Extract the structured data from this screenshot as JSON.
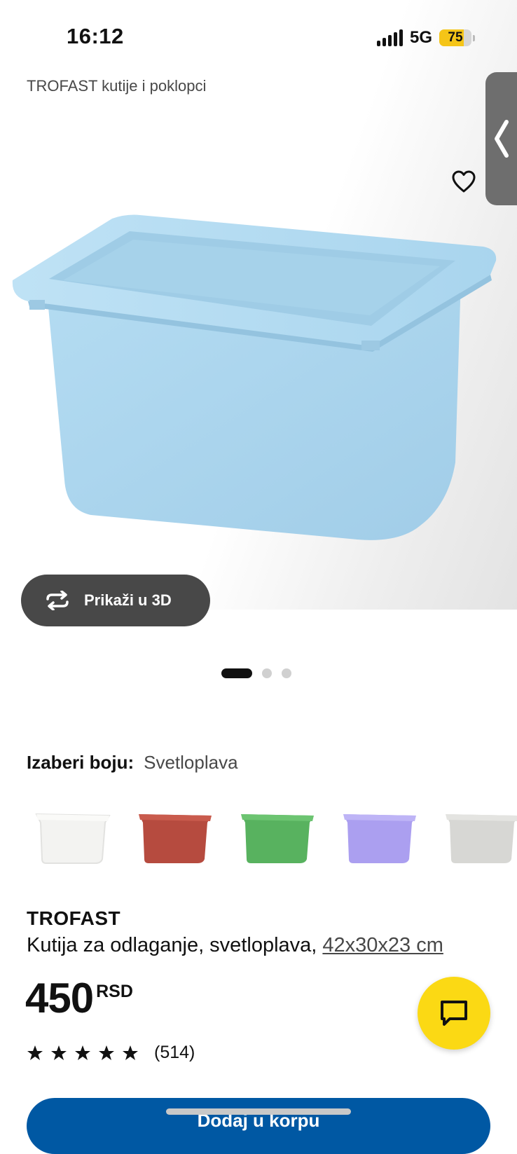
{
  "status_bar": {
    "time": "16:12",
    "network": "5G",
    "battery": "75",
    "battery_level": 0.75
  },
  "breadcrumb": "TROFAST kutije i poklopci",
  "colors": {
    "accent_yellow": "#fbd914",
    "brand_blue": "#0058a3",
    "product_color": "#a8d4ee"
  },
  "gallery": {
    "view_3d_label": "Prikaži u 3D",
    "view_3d_icon": "rotate-arrows-icon",
    "favorite_icon": "heart-icon",
    "side_tab_icon": "chevron-left-icon",
    "dots_count": 3,
    "active_dot": 1
  },
  "color_select": {
    "label": "Izaberi boju:",
    "value": "Svetloplava",
    "options": [
      "bela",
      "crvena",
      "zelena",
      "lila",
      "siva"
    ]
  },
  "product": {
    "name": "TROFAST",
    "description": "Kutija za odlaganje, svetloplava, ",
    "dimensions": "42x30x23 cm",
    "price": "450",
    "currency": "RSD",
    "rating_stars": 5,
    "rating_count": "(514)"
  },
  "chat_icon": "chat-bubble-icon",
  "cta_label": "Dodaj u korpu"
}
